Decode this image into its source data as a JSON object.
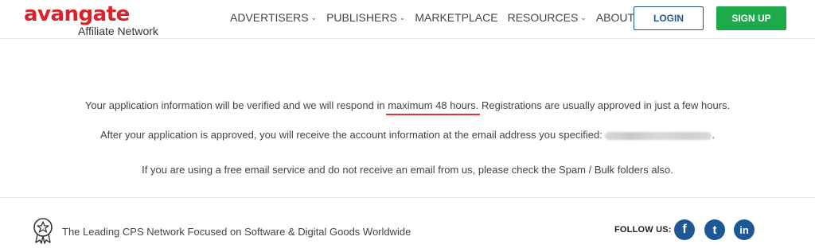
{
  "brand": {
    "logo_text": "avangate",
    "subtitle": "Affiliate Network",
    "accent_color": "#d8232a"
  },
  "nav": {
    "items": [
      {
        "label": "ADVERTISERS",
        "has_dropdown": true
      },
      {
        "label": "PUBLISHERS",
        "has_dropdown": true
      },
      {
        "label": "MARKETPLACE",
        "has_dropdown": false
      },
      {
        "label": "RESOURCES",
        "has_dropdown": true
      },
      {
        "label": "ABOUT US",
        "has_dropdown": true
      }
    ]
  },
  "header_actions": {
    "login_label": "LOGIN",
    "signup_label": "SIGN UP",
    "signup_color": "#1ea94a"
  },
  "messages": {
    "line1_before": "Your application information will be verified and we will respond in ",
    "line1_highlight": "maximum 48 hours.",
    "line1_after": " Registrations are usually approved in just a few hours.",
    "line2_before": "After your application is approved, you will receive the account information at the email address you specified: ",
    "line2_after": ".",
    "line3": "If you are using a free email service and do not receive an email from us, please check the Spam / Bulk folders also."
  },
  "footer": {
    "icon": "star-badge-icon",
    "tagline": "The Leading CPS Network Focused on Software & Digital Goods Worldwide",
    "follow_label": "FOLLOW US:",
    "social": [
      {
        "icon": "facebook-icon",
        "glyph": "f"
      },
      {
        "icon": "twitter-icon",
        "glyph": "t"
      },
      {
        "icon": "linkedin-icon",
        "glyph": "in"
      }
    ]
  }
}
